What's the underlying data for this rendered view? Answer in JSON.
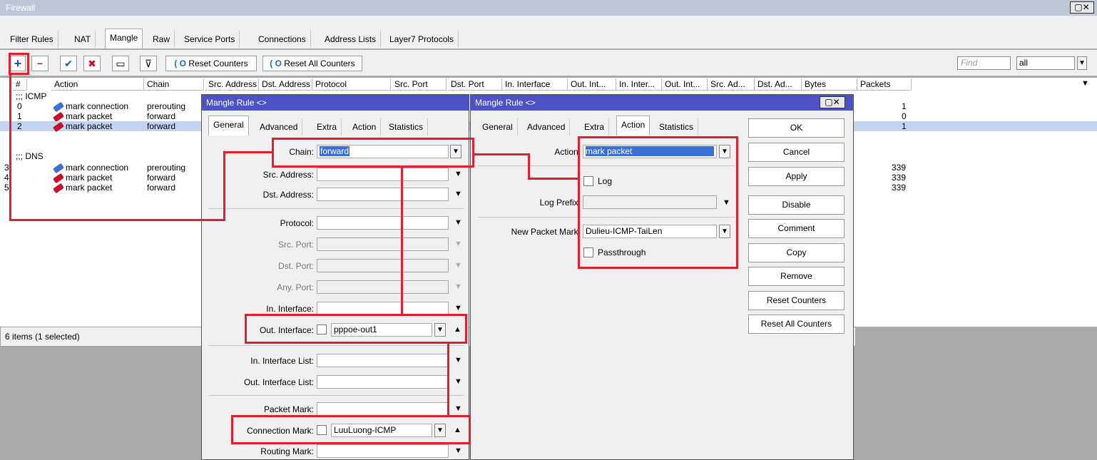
{
  "window": {
    "title": "Firewall",
    "controls": "▢✕"
  },
  "tabs": [
    "Filter Rules",
    "NAT",
    "Mangle",
    "Raw",
    "Service Ports",
    "Connections",
    "Address Lists",
    "Layer7 Protocols"
  ],
  "toolbar": {
    "add": "+",
    "remove": "−",
    "enable": "✔",
    "disable": "✖",
    "comment": "▭",
    "filter": "⊽",
    "reset_counters": "Reset Counters",
    "reset_all_counters": "Reset All Counters",
    "find_placeholder": "Find",
    "filter_value": "all"
  },
  "table": {
    "headers": [
      "#",
      "Action",
      "Chain",
      "Src. Address",
      "Dst. Address",
      "Protocol",
      "Src. Port",
      "Dst. Port",
      "In. Interface",
      "Out. Int...",
      "In. Inter...",
      "Out. Int...",
      "Src. Ad...",
      "Dst. Ad...",
      "Bytes",
      "Packets"
    ],
    "groups": [
      {
        "label": ";;; ICMP",
        "rows": [
          {
            "num": "0",
            "action": "mark connection",
            "chain": "prerouting",
            "packets": "1"
          },
          {
            "num": "1",
            "action": "mark packet",
            "chain": "forward",
            "packets": "0"
          },
          {
            "num": "2",
            "action": "mark packet",
            "chain": "forward",
            "packets": "1"
          }
        ]
      },
      {
        "label": ";;; DNS",
        "rows": [
          {
            "num": "3",
            "action": "mark connection",
            "chain": "prerouting",
            "packets": "339"
          },
          {
            "num": "4",
            "action": "mark packet",
            "chain": "forward",
            "packets": "339"
          },
          {
            "num": "5",
            "action": "mark packet",
            "chain": "forward",
            "packets": "339"
          }
        ]
      }
    ],
    "status": "6 items (1 selected)"
  },
  "dialog_general": {
    "title": "Mangle Rule <>",
    "tabs": [
      "General",
      "Advanced",
      "Extra",
      "Action",
      "Statistics"
    ],
    "fields": {
      "chain_label": "Chain:",
      "chain_value": "forward",
      "src_address_label": "Src. Address:",
      "dst_address_label": "Dst. Address:",
      "protocol_label": "Protocol:",
      "src_port_label": "Src. Port:",
      "dst_port_label": "Dst. Port:",
      "any_port_label": "Any. Port:",
      "in_interface_label": "In. Interface:",
      "out_interface_label": "Out. Interface:",
      "out_interface_value": "pppoe-out1",
      "in_interface_list_label": "In. Interface List:",
      "out_interface_list_label": "Out. Interface List:",
      "packet_mark_label": "Packet Mark:",
      "connection_mark_label": "Connection Mark:",
      "connection_mark_value": "LuuLuong-ICMP",
      "routing_mark_label": "Routing Mark:"
    }
  },
  "dialog_action": {
    "title": "Mangle Rule <>",
    "tabs": [
      "General",
      "Advanced",
      "Extra",
      "Action",
      "Statistics"
    ],
    "fields": {
      "action_label": "Action:",
      "action_value": "mark packet",
      "log_label": "Log",
      "log_prefix_label": "Log Prefix:",
      "new_packet_mark_label": "New Packet Mark:",
      "new_packet_mark_value": "Dulieu-ICMP-TaiLen",
      "passthrough_label": "Passthrough"
    },
    "buttons": [
      "OK",
      "Cancel",
      "Apply",
      "Disable",
      "Comment",
      "Copy",
      "Remove",
      "Reset Counters",
      "Reset All Counters"
    ]
  },
  "colors": {
    "title_blue": "#4b53c6",
    "selection": "#c4d3ef",
    "highlight_red": "#e0202f",
    "pencil_blue": "#3b6fd0",
    "pencil_red": "#c8102e"
  }
}
